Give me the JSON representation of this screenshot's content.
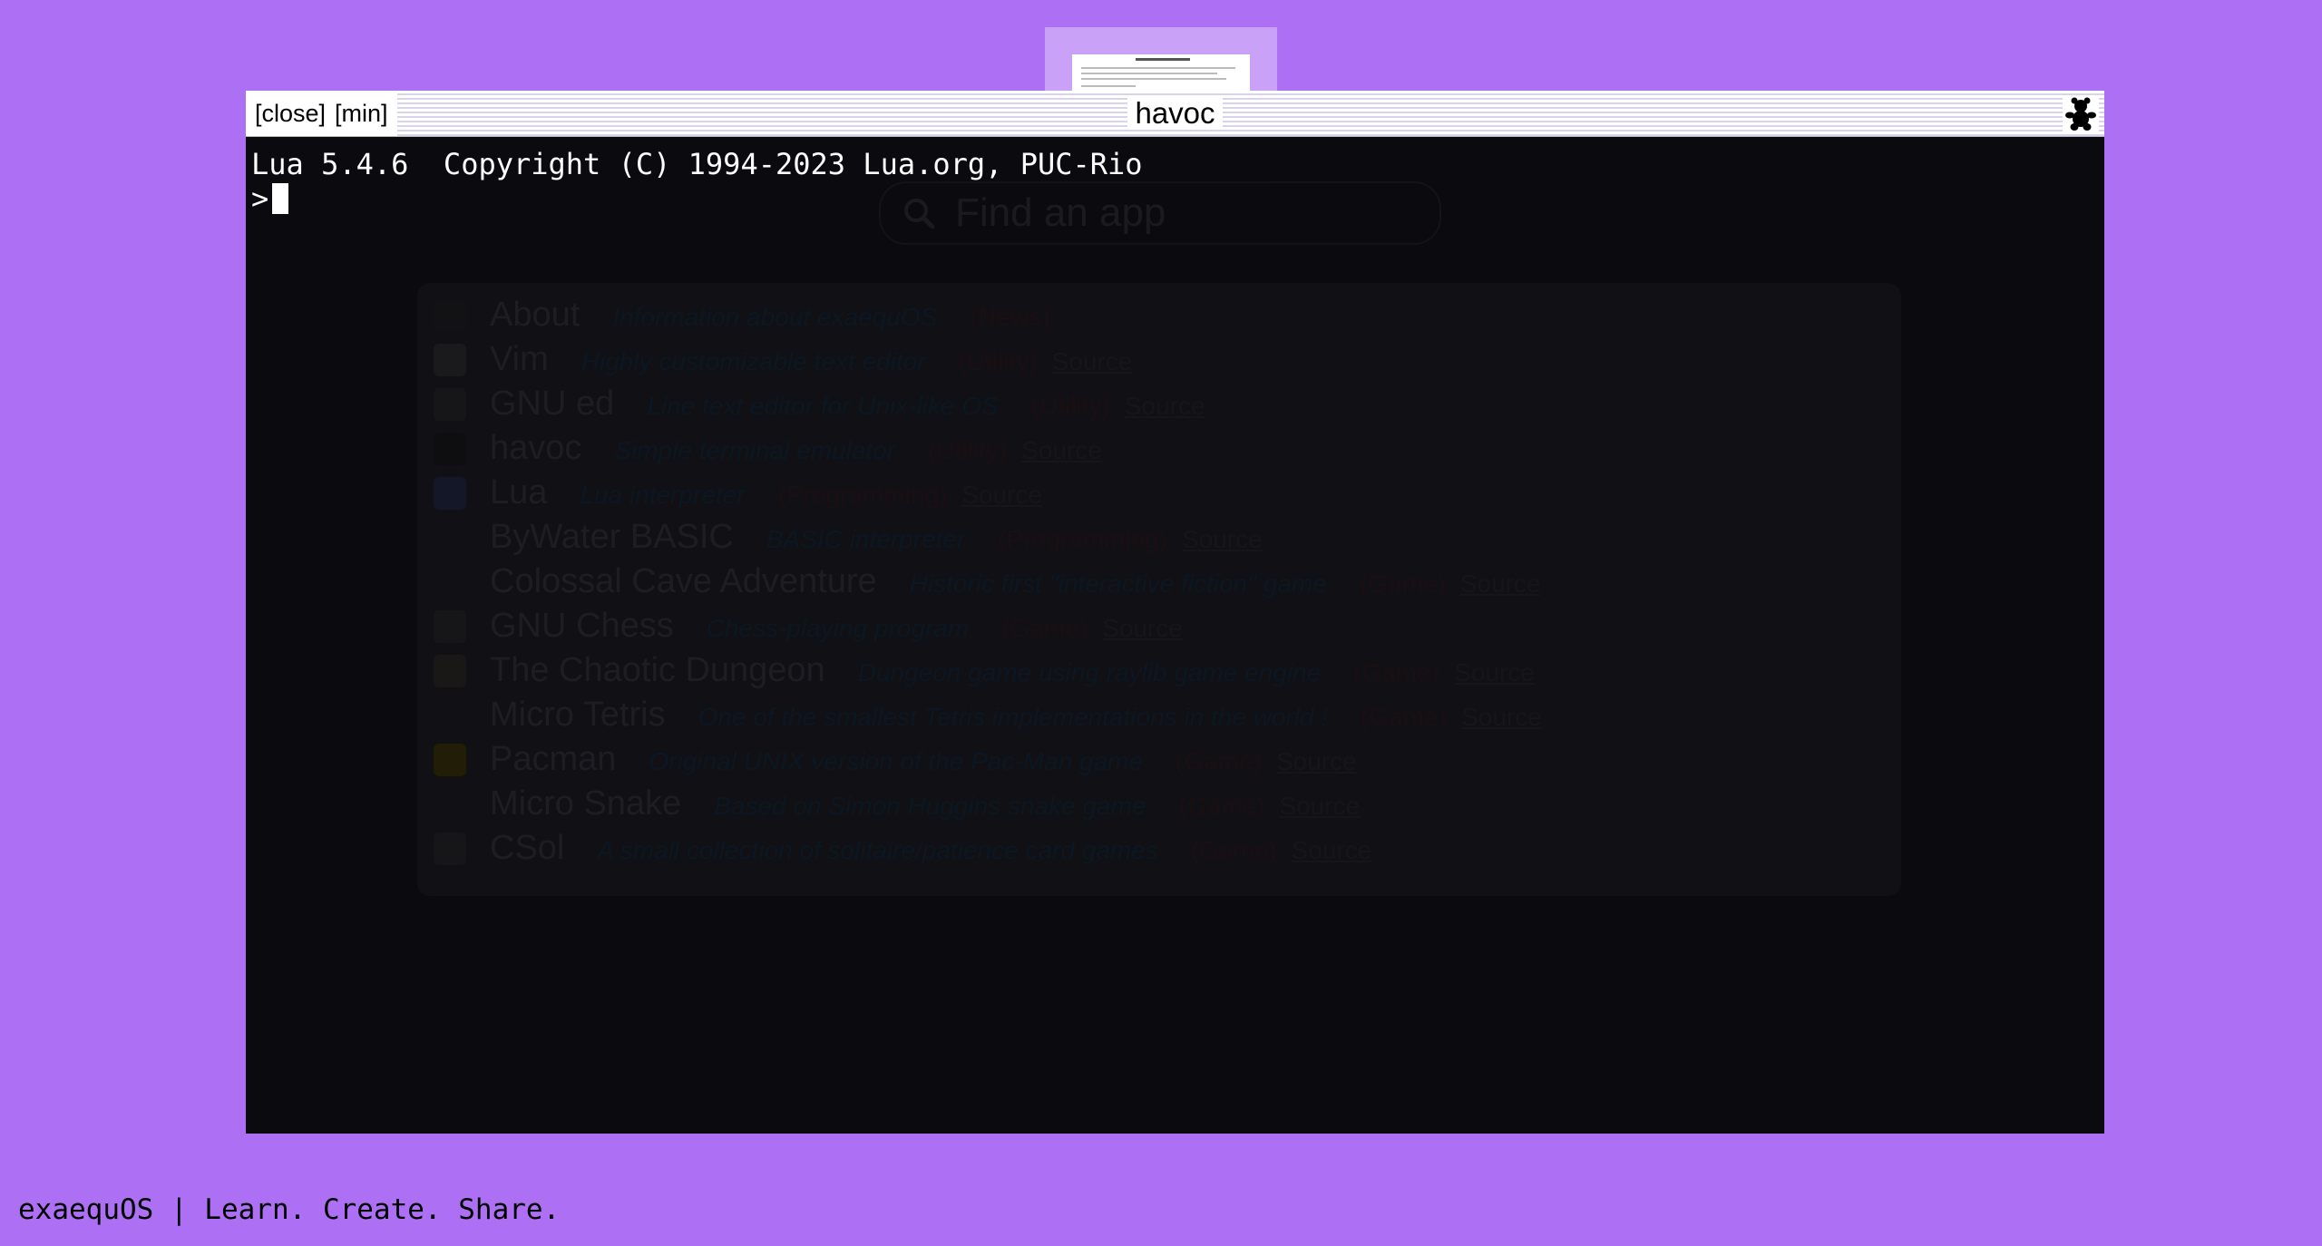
{
  "thumbnail": {
    "title": "Welcome to exaequOS"
  },
  "window": {
    "controls": {
      "close": "[close]",
      "min": "[min]"
    },
    "title": "havoc",
    "bear_icon": "bear-icon"
  },
  "terminal": {
    "banner": "Lua 5.4.6  Copyright (C) 1994-2023 Lua.org, PUC-Rio",
    "prompt": ">"
  },
  "finder": {
    "search_placeholder": "Find an app",
    "apps": [
      {
        "name": "About",
        "desc": "Information about exaequOS",
        "cat": "(News)",
        "src": ""
      },
      {
        "name": "Vim",
        "desc": "Highly customizable text editor",
        "cat": "(Utility)",
        "src": "Source"
      },
      {
        "name": "GNU ed",
        "desc": "Line text editor for Unix-like OS",
        "cat": "(Utility)",
        "src": "Source"
      },
      {
        "name": "havoc",
        "desc": "Simple terminal emulator",
        "cat": "(Utility)",
        "src": "Source"
      },
      {
        "name": "Lua",
        "desc": "Lua interpreter",
        "cat": "(Programming)",
        "src": "Source"
      },
      {
        "name": "ByWater BASIC",
        "desc": "BASIC interpreter",
        "cat": "(Programming)",
        "src": "Source"
      },
      {
        "name": "Colossal Cave Adventure",
        "desc": "Historic first \"interactive fiction\" game",
        "cat": "(Game)",
        "src": "Source"
      },
      {
        "name": "GNU Chess",
        "desc": "Chess-playing program",
        "cat": "(Game)",
        "src": "Source"
      },
      {
        "name": "The Chaotic Dungeon",
        "desc": "Dungeon game using raylib game engine",
        "cat": "(Game)",
        "src": "Source"
      },
      {
        "name": "Micro Tetris",
        "desc": "One of the smallest Tetris implementations in the world !",
        "cat": "(Game)",
        "src": "Source"
      },
      {
        "name": "Pacman",
        "desc": "Original UNIX version of the Pac-Man game",
        "cat": "(Game)",
        "src": "Source"
      },
      {
        "name": "Micro Snake",
        "desc": "Based on Simon Huggins snake game",
        "cat": "(Game)",
        "src": "Source"
      },
      {
        "name": "CSol",
        "desc": "A small collection of solitaire/patience card games",
        "cat": "(Game)",
        "src": "Source"
      }
    ]
  },
  "footer": {
    "text": "exaequOS | Learn. Create. Share."
  }
}
